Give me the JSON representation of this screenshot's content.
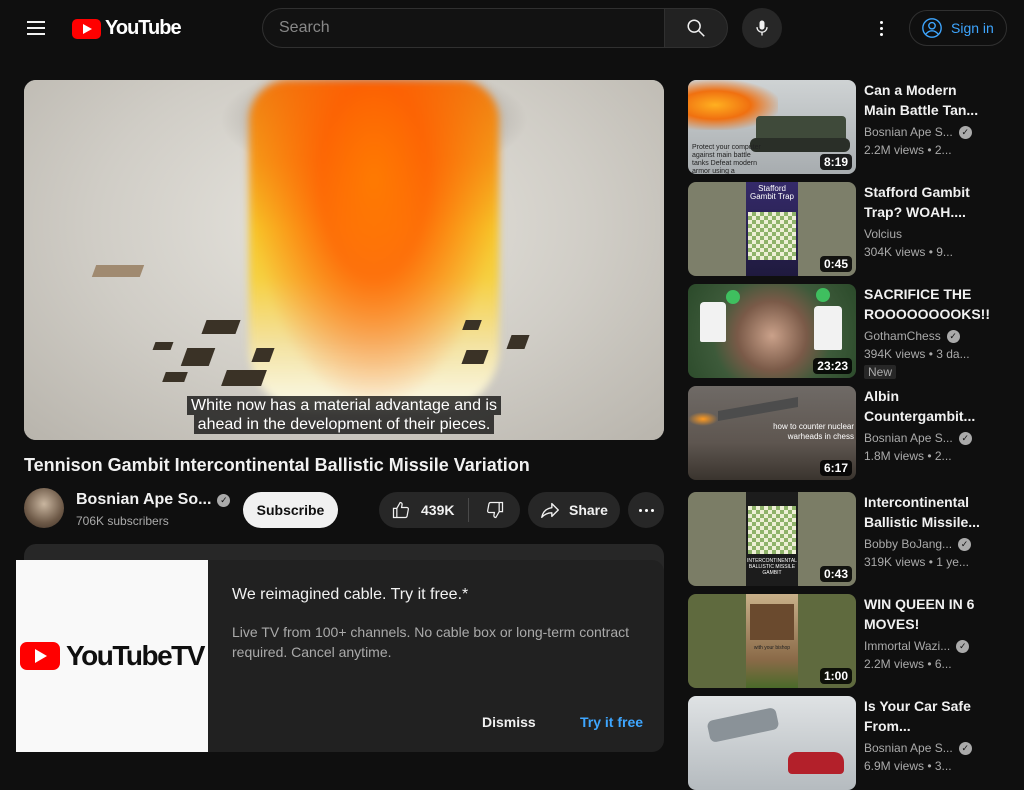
{
  "header": {
    "logo_text": "YouTube",
    "search_placeholder": "Search",
    "sign_in": "Sign in"
  },
  "player": {
    "caption_line1": "White now has a material advantage and is",
    "caption_line2": "ahead in the development of their pieces."
  },
  "video": {
    "title": "Tennison Gambit Intercontinental Ballistic Missile Variation",
    "channel": "Bosnian Ape So...",
    "subscribers": "706K subscribers",
    "subscribe": "Subscribe",
    "likes": "439K",
    "share": "Share"
  },
  "promo": {
    "logo_text": "YouTubeTV",
    "title": "We reimagined cable. Try it free.*",
    "body": "Live TV from 100+ channels. No cable box or long-term contract required. Cancel anytime.",
    "dismiss": "Dismiss",
    "try": "Try it free"
  },
  "recommendations": [
    {
      "title": "Can a Modern Main Battle Tan...",
      "channel": "Bosnian Ape S...",
      "verified": true,
      "meta": "2.2M views • 2...",
      "duration": "8:19",
      "thumb_text": "Protect your computer against main battle tanks Defeat modern armor using a keyboard"
    },
    {
      "title": "Stafford Gambit Trap? WOAH....",
      "channel": "Volcius",
      "verified": false,
      "meta": "304K views • 9...",
      "duration": "0:45",
      "thumb_text": "Stafford Gambit Trap"
    },
    {
      "title": "SACRIFICE THE ROOOOOOOOKS!!",
      "channel": "GothamChess",
      "verified": true,
      "meta": "394K views • 3 da...",
      "duration": "23:23",
      "badge": "New"
    },
    {
      "title": "Albin Countergambit...",
      "channel": "Bosnian Ape S...",
      "verified": true,
      "meta": "1.8M views • 2...",
      "duration": "6:17",
      "thumb_text": "how to counter nuclear warheads in chess"
    },
    {
      "title": "Intercontinental Ballistic Missile...",
      "channel": "Bobby BoJang...",
      "verified": true,
      "meta": "319K views • 1 ye...",
      "duration": "0:43",
      "thumb_text": "INTERCONTINENTAL BALLISTIC MISSILE GAMBIT"
    },
    {
      "title": "WIN QUEEN IN 6 MOVES!",
      "channel": "Immortal Wazi...",
      "verified": true,
      "meta": "2.2M views • 6...",
      "duration": "1:00",
      "thumb_text": "with your bishop"
    },
    {
      "title": "Is Your Car Safe From...",
      "channel": "Bosnian Ape S...",
      "verified": true,
      "meta": "6.9M views • 3...",
      "duration": ""
    }
  ]
}
